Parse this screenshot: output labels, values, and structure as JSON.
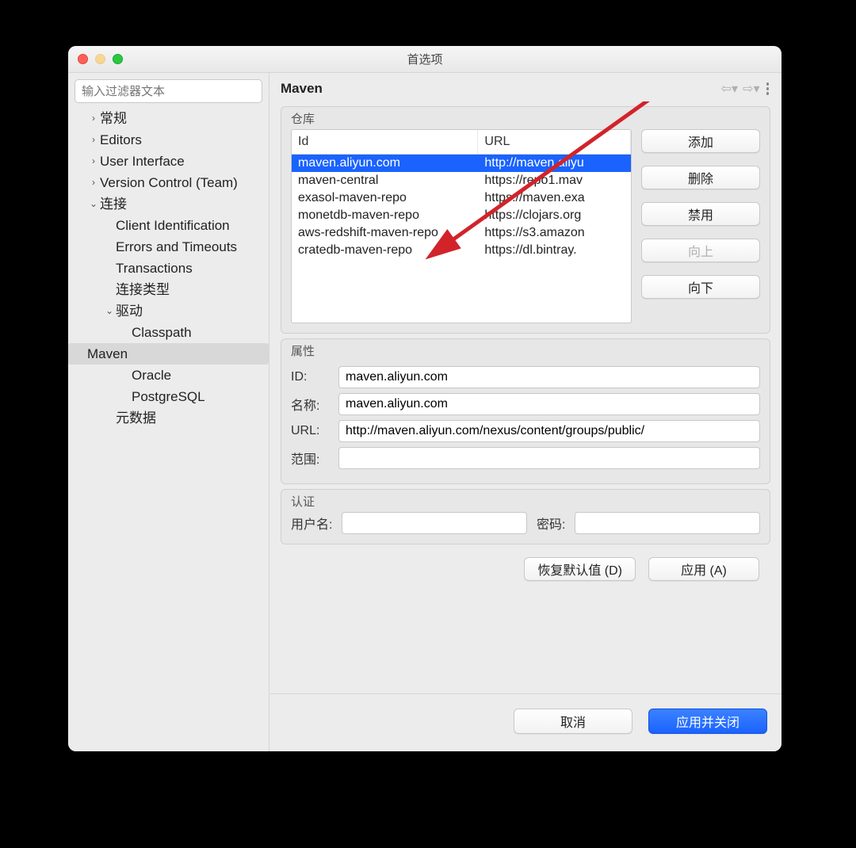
{
  "window": {
    "title": "首选项"
  },
  "sidebar": {
    "filter_placeholder": "输入过滤器文本",
    "items": {
      "general": "常规",
      "editors": "Editors",
      "ui": "User Interface",
      "vcs": "Version Control (Team)",
      "connection": "连接",
      "client_id": "Client Identification",
      "errors": "Errors and Timeouts",
      "transactions": "Transactions",
      "conn_types": "连接类型",
      "drivers": "驱动",
      "classpath": "Classpath",
      "maven": "Maven",
      "oracle": "Oracle",
      "postgresql": "PostgreSQL",
      "metadata": "元数据"
    }
  },
  "main": {
    "title": "Maven",
    "repos_legend": "仓库",
    "repo_head_id": "Id",
    "repo_head_url": "URL",
    "repos": [
      {
        "id": "maven.aliyun.com",
        "url": "http://maven.aliyu"
      },
      {
        "id": "maven-central",
        "url": "https://repo1.mav"
      },
      {
        "id": "exasol-maven-repo",
        "url": "https://maven.exa"
      },
      {
        "id": "monetdb-maven-repo",
        "url": "https://clojars.org"
      },
      {
        "id": "aws-redshift-maven-repo",
        "url": "https://s3.amazon"
      },
      {
        "id": "cratedb-maven-repo",
        "url": "https://dl.bintray."
      }
    ],
    "selected_index": 0,
    "buttons": {
      "add": "添加",
      "delete": "删除",
      "disable": "禁用",
      "up": "向上",
      "down": "向下"
    },
    "props_legend": "属性",
    "props": {
      "id_label": "ID:",
      "id_value": "maven.aliyun.com",
      "name_label": "名称:",
      "name_value": "maven.aliyun.com",
      "url_label": "URL:",
      "url_value": "http://maven.aliyun.com/nexus/content/groups/public/",
      "scope_label": "范围:",
      "scope_value": ""
    },
    "auth_legend": "认证",
    "auth": {
      "user_label": "用户名:",
      "user_value": "",
      "pass_label": "密码:",
      "pass_value": ""
    },
    "restore_defaults": "恢复默认值 (D)",
    "apply": "应用 (A)"
  },
  "footer": {
    "cancel": "取消",
    "apply_close": "应用并关闭"
  }
}
